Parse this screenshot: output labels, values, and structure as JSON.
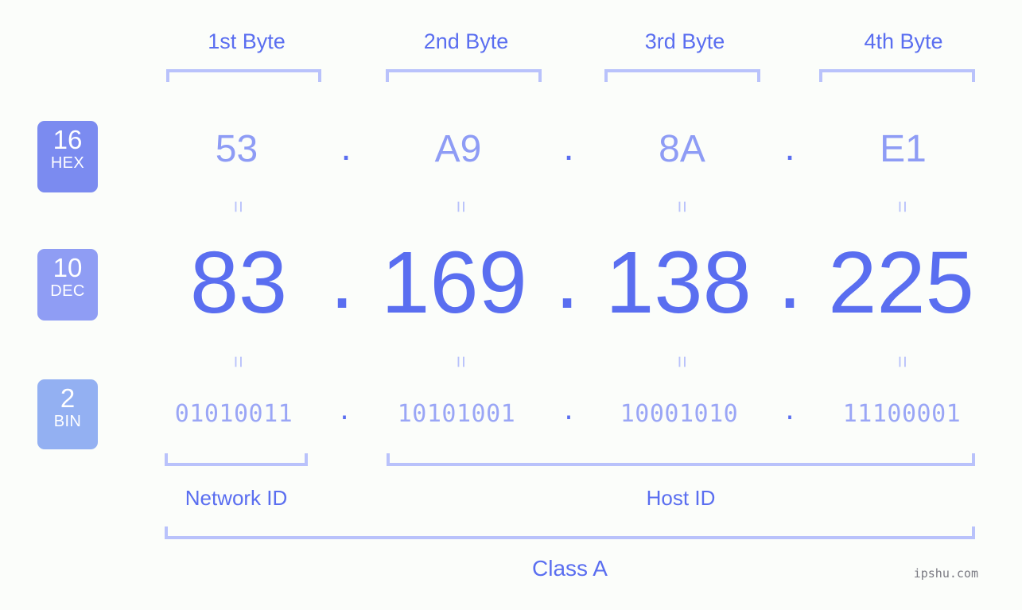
{
  "background_color": "#fbfdfa",
  "accent_color": "#5a6ef0",
  "accent_light_color": "#8e9cf5",
  "bracket_color": "#b9c2fb",
  "header": {
    "byte_labels": [
      "1st Byte",
      "2nd Byte",
      "3rd Byte",
      "4th Byte"
    ]
  },
  "bases": [
    {
      "number": "16",
      "abbr": "HEX",
      "color": "#7b8bf0"
    },
    {
      "number": "10",
      "abbr": "DEC",
      "color": "#8f9df4"
    },
    {
      "number": "2",
      "abbr": "BIN",
      "color": "#93b0f2"
    }
  ],
  "rows": {
    "hex": {
      "values": [
        "53",
        "A9",
        "8A",
        "E1"
      ],
      "separator": "."
    },
    "dec": {
      "values": [
        "83",
        "169",
        "138",
        "225"
      ],
      "separator": "."
    },
    "bin": {
      "values": [
        "01010011",
        "10101001",
        "10001010",
        "11100001"
      ],
      "separator": "."
    }
  },
  "equals_marks": {
    "symbol": "=",
    "count_per_row": 4
  },
  "sections": {
    "network_id_label": "Network ID",
    "host_id_label": "Host ID",
    "class_label": "Class A"
  },
  "watermark": "ipshu.com",
  "chart_data": {
    "type": "table",
    "title": "IP address byte breakdown",
    "ip_address": "83.169.138.225",
    "ip_class": "Class A",
    "columns": [
      "1st Byte",
      "2nd Byte",
      "3rd Byte",
      "4th Byte"
    ],
    "rows": [
      {
        "base": 16,
        "base_abbr": "HEX",
        "values": [
          "53",
          "A9",
          "8A",
          "E1"
        ]
      },
      {
        "base": 10,
        "base_abbr": "DEC",
        "values": [
          "83",
          "169",
          "138",
          "225"
        ]
      },
      {
        "base": 2,
        "base_abbr": "BIN",
        "values": [
          "01010011",
          "10101001",
          "10001010",
          "11100001"
        ]
      }
    ],
    "network_id_bytes": [
      "1st Byte"
    ],
    "host_id_bytes": [
      "2nd Byte",
      "3rd Byte",
      "4th Byte"
    ],
    "network_id_label": "Network ID",
    "host_id_label": "Host ID"
  }
}
